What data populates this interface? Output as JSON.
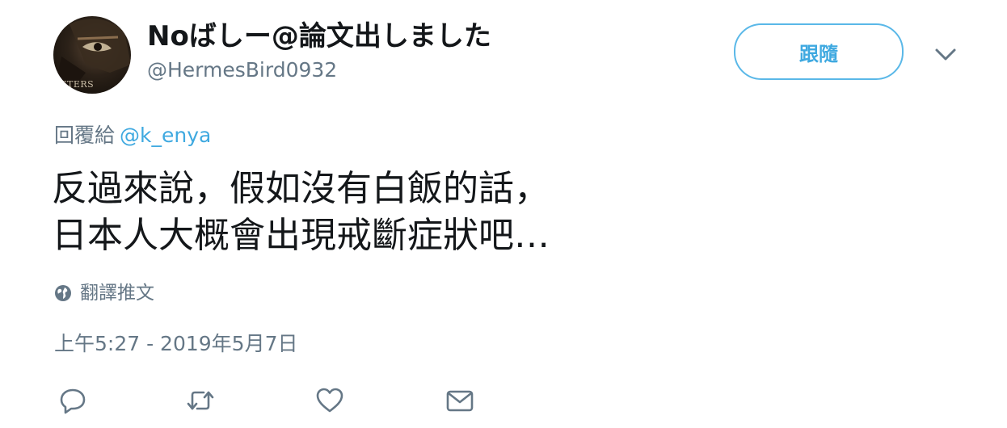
{
  "author": {
    "display_name": "Noばしー@論文出しました",
    "handle": "@HermesBird0932",
    "avatar_caption": "IFTERS"
  },
  "follow_button": {
    "label": "跟隨"
  },
  "reply_context": {
    "prefix": "回覆給",
    "mention": "@k_enya"
  },
  "tweet": {
    "text": "反過來說，假如沒有白飯的話，\n日本人大概會出現戒斷症狀吧…",
    "translate_label": "翻譯推文",
    "timestamp": "上午5:27 - 2019年5月7日"
  },
  "icons": {
    "caret": "chevron-down-icon",
    "globe": "globe-icon",
    "reply": "reply-icon",
    "retweet": "retweet-icon",
    "like": "heart-icon",
    "message": "envelope-icon"
  },
  "colors": {
    "accent": "#3fa9e0",
    "muted": "#657786",
    "text": "#14171a"
  }
}
